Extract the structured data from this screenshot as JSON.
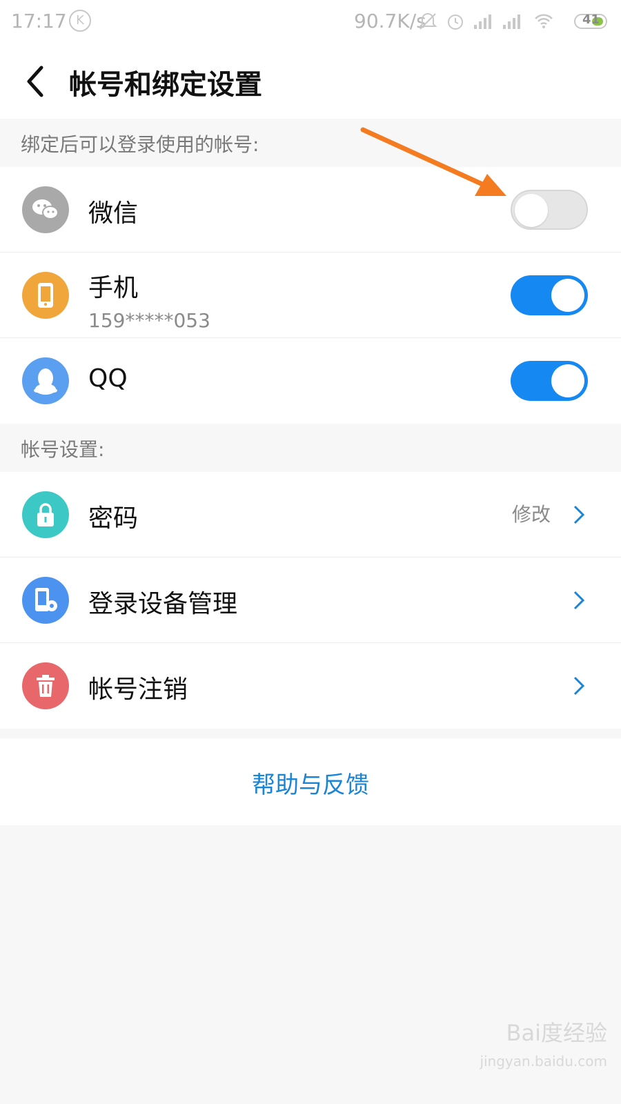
{
  "status_bar": {
    "time": "17:17",
    "k_badge": "K",
    "net_speed": "90.7K/s",
    "battery": "41",
    "icons": [
      "silent-bell-icon",
      "alarm-icon",
      "signal-icon",
      "signal-icon",
      "wifi-icon",
      "battery-icon"
    ]
  },
  "header": {
    "title": "帐号和绑定设置"
  },
  "bind_section": {
    "label": "绑定后可以登录使用的帐号:",
    "items": [
      {
        "label": "微信",
        "icon": "wechat-icon",
        "icon_color": "#a9a9a9",
        "enabled": false
      },
      {
        "label": "手机",
        "sublabel": "159*****053",
        "icon": "phone-icon",
        "icon_color": "#f0a63a",
        "enabled": true
      },
      {
        "label": "QQ",
        "icon": "qq-icon",
        "icon_color": "#5b9ff0",
        "enabled": true
      }
    ]
  },
  "account_section": {
    "label": "帐号设置:",
    "items": [
      {
        "label": "密码",
        "action": "修改",
        "icon": "lock-icon",
        "icon_color": "#3cc9c6"
      },
      {
        "label": "登录设备管理",
        "icon": "device-settings-icon",
        "icon_color": "#4c93ef"
      },
      {
        "label": "帐号注销",
        "icon": "trash-icon",
        "icon_color": "#e8676b"
      }
    ]
  },
  "help": {
    "label": "帮助与反馈"
  },
  "watermark": {
    "brand": "Bai度经验",
    "site": "jingyan.baidu.com"
  },
  "colors": {
    "toggle_on": "#1688f2",
    "link": "#1a84d6",
    "annotation_arrow": "#f47b20"
  }
}
